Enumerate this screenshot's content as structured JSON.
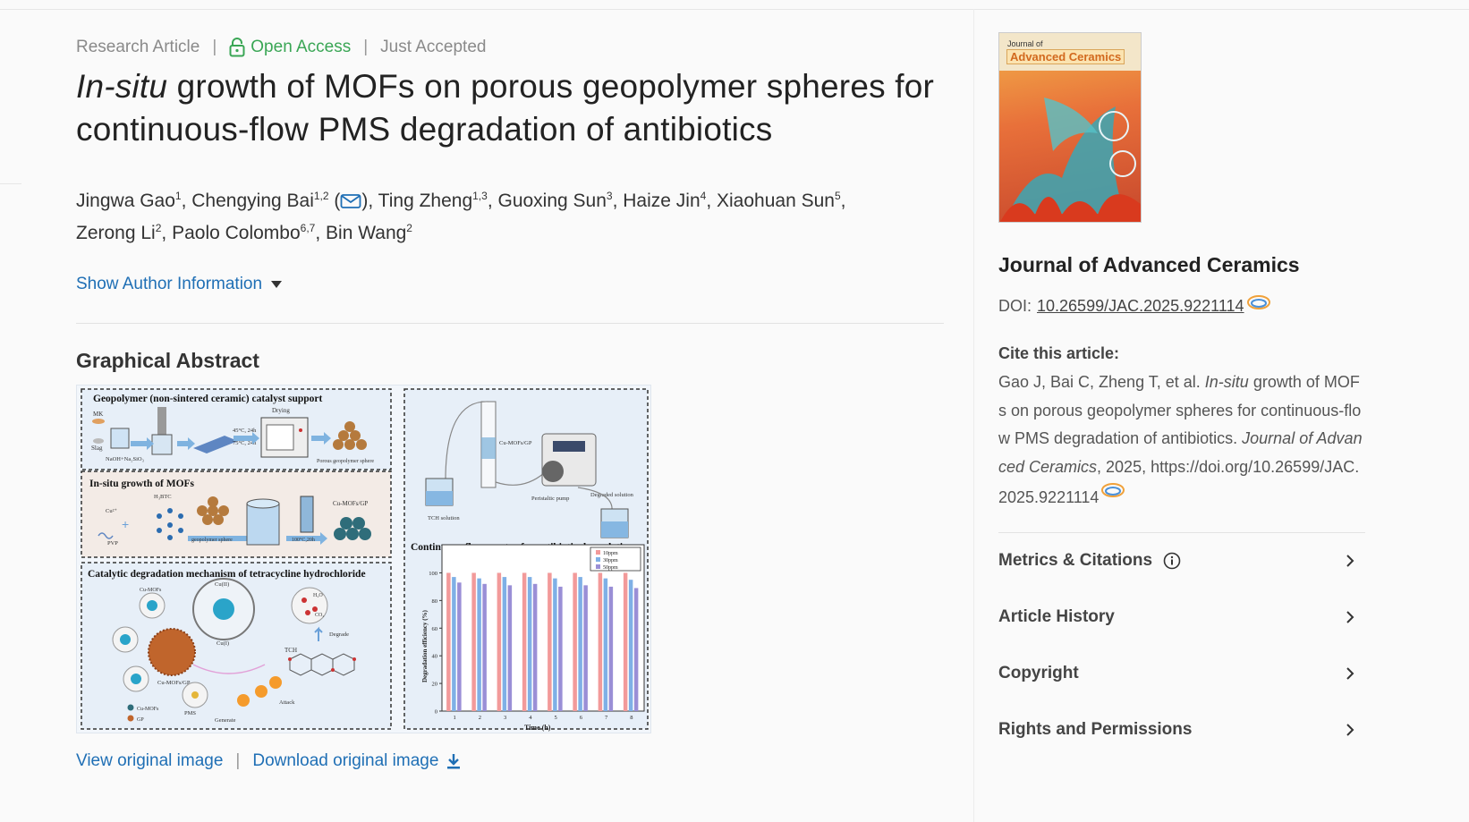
{
  "article": {
    "type": "Research Article",
    "open_access": "Open Access",
    "status": "Just Accepted",
    "title_italic": "In-situ",
    "title_rest": " growth of MOFs on porous geopolymer spheres for continuous-flow PMS degradation of antibiotics",
    "authors": [
      {
        "name": "Jingwa Gao",
        "aff": "1"
      },
      {
        "name": "Chengying Bai",
        "aff": "1,2"
      },
      {
        "name": "Ting Zheng",
        "aff": "1,3"
      },
      {
        "name": "Guoxing Sun",
        "aff": "3"
      },
      {
        "name": "Haize Jin",
        "aff": "4"
      },
      {
        "name": "Xiaohuan Sun",
        "aff": "5"
      },
      {
        "name": "Zerong Li",
        "aff": "2"
      },
      {
        "name": "Paolo Colombo",
        "aff": "6,7"
      },
      {
        "name": "Bin Wang",
        "aff": "2"
      }
    ],
    "show_author_info": "Show Author Information",
    "graphical_abstract": "Graphical Abstract",
    "view_image": "View original image",
    "download_image": "Download original image"
  },
  "figure": {
    "panel1": "Geopolymer (non-sintered ceramic) catalyst support",
    "panel2": "In-situ growth of MOFs",
    "panel3": "Catalytic degradation mechanism of tetracycline hydrochloride",
    "panel4": "Continuous-flow reactor for antibiotic degradation",
    "labels": {
      "mk": "MK",
      "slag": "Slag",
      "naoh": "NaOH+Na₂SiO₃",
      "drying": "Drying",
      "t1": "45°C, 24h",
      "t2": "75°C, 24h",
      "porous": "Porous geopolymer sphere",
      "cu": "Cu²⁺",
      "h3btc": "H₃BTC",
      "pvp": "PVP",
      "gsphere": "geopolymer sphere",
      "cond": "100°C,20h",
      "cumofsgp": "Cu-MOFs/GP",
      "cumofs": "Cu-MOFs",
      "cu2": "Cu(II)",
      "cu1": "Cu(I)",
      "h2o": "H₂O",
      "co2": "CO₂",
      "degrade": "Degrade",
      "tch": "TCH",
      "pms": "PMS",
      "generate": "Generate",
      "attack": "Attack",
      "gp": "GP",
      "tchsol": "TCH solution",
      "pump": "Peristaltic pump",
      "degsol": "Degraded solution"
    },
    "chart": {
      "ylabel": "Degradation efficiency (%)",
      "xlabel": "Time (h)",
      "yticks": [
        "0",
        "20",
        "40",
        "60",
        "80",
        "100"
      ],
      "xticks": [
        "1",
        "2",
        "3",
        "4",
        "5",
        "6",
        "7",
        "8"
      ],
      "legend": [
        "10ppm",
        "30ppm",
        "50ppm"
      ],
      "colors": [
        "#f29a9a",
        "#7fb0e6",
        "#9a8fd6"
      ],
      "values": [
        [
          100,
          97,
          93
        ],
        [
          100,
          96,
          92
        ],
        [
          100,
          97,
          91
        ],
        [
          100,
          97,
          92
        ],
        [
          100,
          96,
          90
        ],
        [
          100,
          97,
          91
        ],
        [
          100,
          96,
          90
        ],
        [
          100,
          95,
          89
        ]
      ]
    }
  },
  "sidebar": {
    "cover_line1": "Journal of",
    "cover_line2": "Advanced Ceramics",
    "journal": "Journal of Advanced Ceramics",
    "doi_label": "DOI:",
    "doi": "10.26599/JAC.2025.9221114",
    "cite_heading": "Cite this article:",
    "cite_pre": "Gao J, Bai C, Zheng T, et al. ",
    "cite_italic": "In-situ",
    "cite_mid": " growth of MOFs on porous geopolymer spheres for continuous-flow PMS degradation of antibiotics. ",
    "cite_journal": "Journal of Advanced Ceramics",
    "cite_post": ", 2025, https://doi.org/10.26599/JAC.2025.9221114",
    "sections": [
      "Metrics & Citations",
      "Article History",
      "Copyright",
      "Rights and Permissions"
    ]
  },
  "colors": {
    "link": "#1f6fb5",
    "open_access": "#3aa655"
  }
}
